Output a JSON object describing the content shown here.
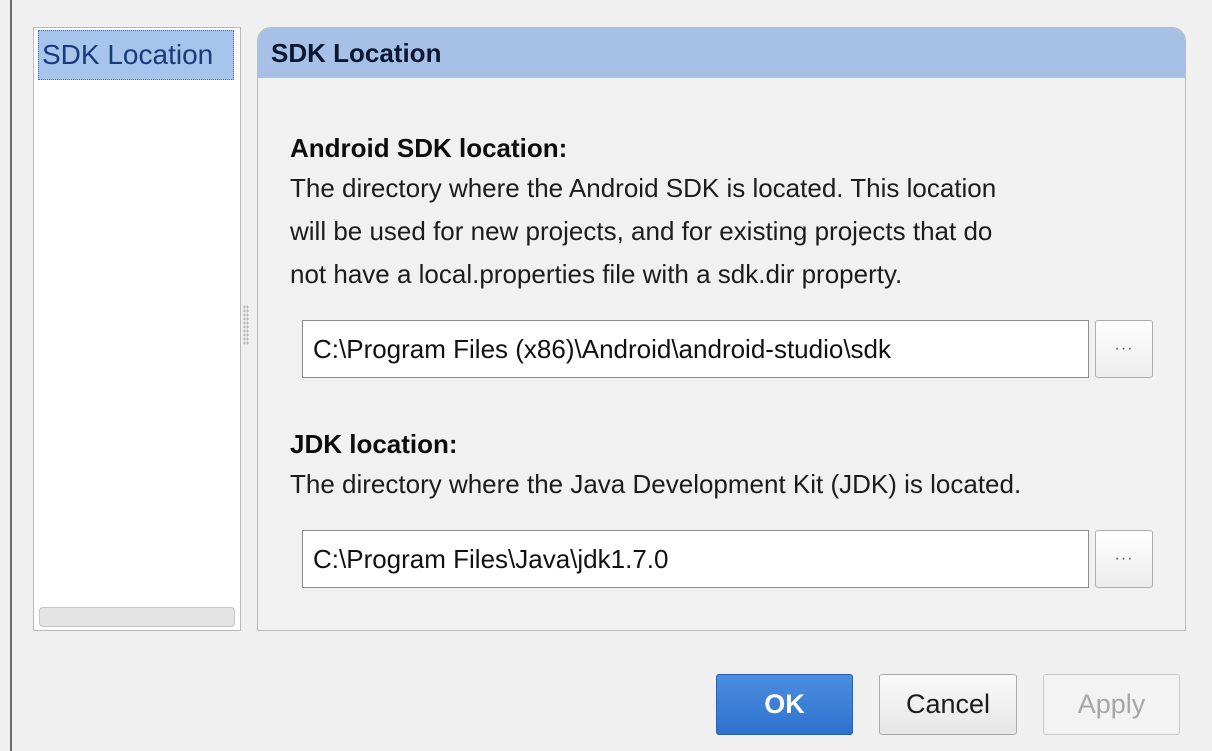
{
  "sidebar": {
    "items": [
      {
        "label": "SDK Location",
        "selected": true
      }
    ]
  },
  "panel": {
    "title": "SDK Location",
    "android_sdk": {
      "title": "Android SDK location:",
      "desc_lines": [
        "The directory where the Android SDK is located. This location",
        "will be used for new projects, and for existing projects that do",
        "not have a local.properties file with a sdk.dir property."
      ],
      "path_value": "C:\\Program Files (x86)\\Android\\android-studio\\sdk",
      "browse_label": "···"
    },
    "jdk": {
      "title": "JDK location:",
      "desc_lines": [
        "The directory where the Java Development Kit (JDK) is located."
      ],
      "path_value": "C:\\Program Files\\Java\\jdk1.7.0",
      "browse_label": "···"
    }
  },
  "buttons": {
    "ok": "OK",
    "cancel": "Cancel",
    "apply": "Apply",
    "apply_enabled": false
  },
  "colors": {
    "selection": "#a6c4ec",
    "header": "#a7c1e6",
    "ok_button": "#3a7dd8"
  }
}
